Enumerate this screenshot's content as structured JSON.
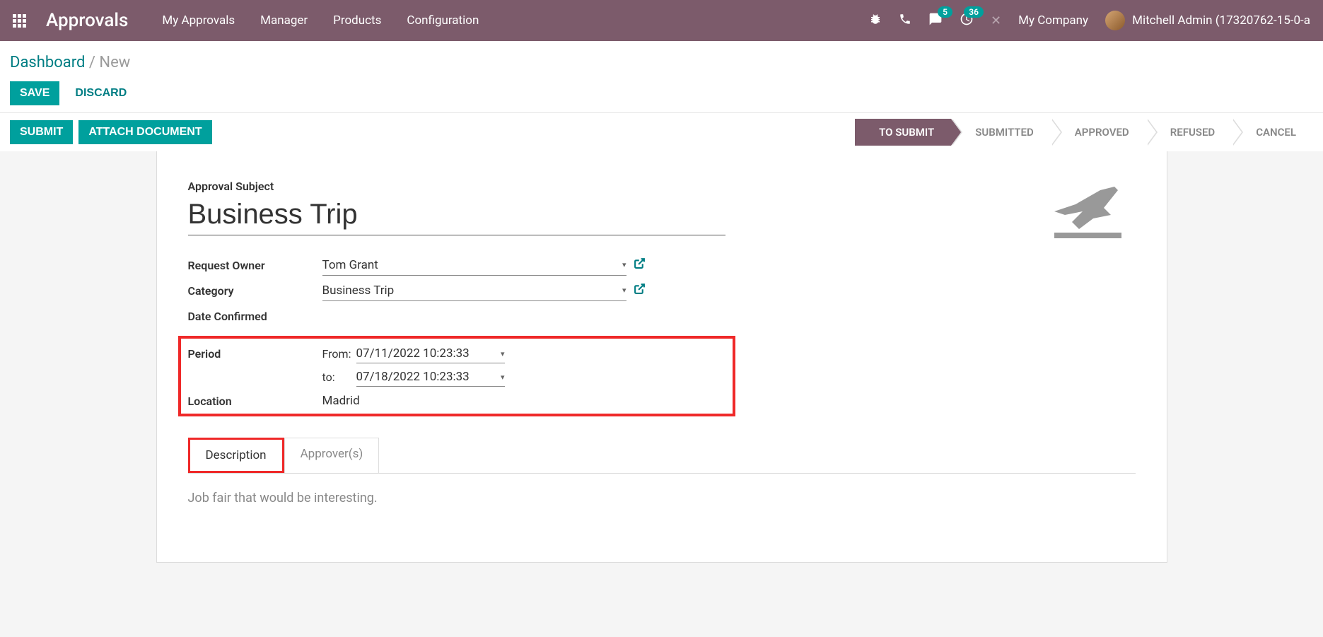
{
  "navbar": {
    "app_name": "Approvals",
    "menu": [
      "My Approvals",
      "Manager",
      "Products",
      "Configuration"
    ],
    "messages_badge": "5",
    "activities_badge": "36",
    "company": "My Company",
    "user": "Mitchell Admin (17320762-15-0-a"
  },
  "breadcrumb": {
    "link": "Dashboard",
    "current": "New"
  },
  "buttons": {
    "save": "SAVE",
    "discard": "DISCARD",
    "submit": "SUBMIT",
    "attach": "ATTACH DOCUMENT"
  },
  "status": {
    "steps": [
      "TO SUBMIT",
      "SUBMITTED",
      "APPROVED",
      "REFUSED",
      "CANCEL"
    ]
  },
  "form": {
    "subject_label": "Approval Subject",
    "subject_value": "Business Trip",
    "request_owner_label": "Request Owner",
    "request_owner_value": "Tom Grant",
    "category_label": "Category",
    "category_value": "Business Trip",
    "date_confirmed_label": "Date Confirmed",
    "period_label": "Period",
    "from_label": "From:",
    "from_value": "07/11/2022 10:23:33",
    "to_label": "to:",
    "to_value": "07/18/2022 10:23:33",
    "location_label": "Location",
    "location_value": "Madrid"
  },
  "tabs": {
    "description": "Description",
    "approvers": "Approver(s)",
    "description_content": "Job fair that would be interesting."
  }
}
